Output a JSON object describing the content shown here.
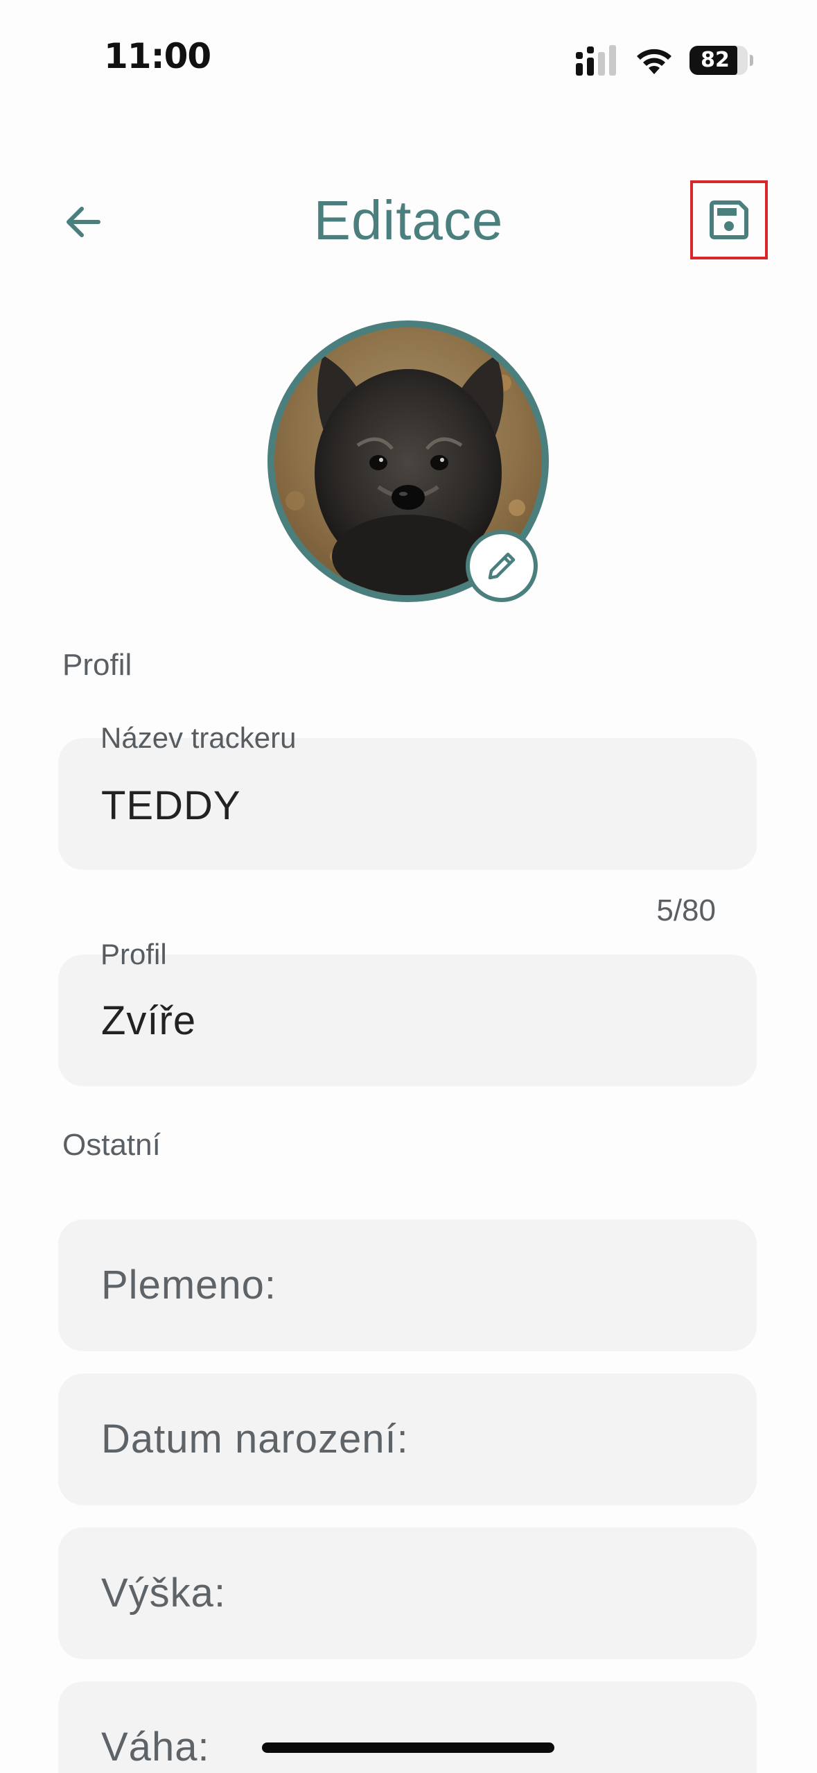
{
  "status_bar": {
    "time": "11:00",
    "battery": "82",
    "battery_level": 0.82
  },
  "header": {
    "title": "Editace",
    "back_icon": "arrow-left-icon",
    "save_icon": "save-floppy-icon"
  },
  "avatar": {
    "edit_icon": "pencil-icon"
  },
  "profile_section": {
    "label": "Profil",
    "tracker_name": {
      "label": "Název trackeru",
      "value": "TEDDY",
      "counter": "5/80"
    },
    "profile": {
      "label": "Profil",
      "value": "Zvíře"
    }
  },
  "other_section": {
    "label": "Ostatní",
    "fields": [
      {
        "placeholder": "Plemeno:"
      },
      {
        "placeholder": "Datum narození:"
      },
      {
        "placeholder": "Výška:"
      },
      {
        "placeholder": "Váha:"
      }
    ]
  },
  "colors": {
    "accent": "#4A7F7E",
    "field_bg": "#F3F3F4",
    "highlight": "#D9262B"
  }
}
